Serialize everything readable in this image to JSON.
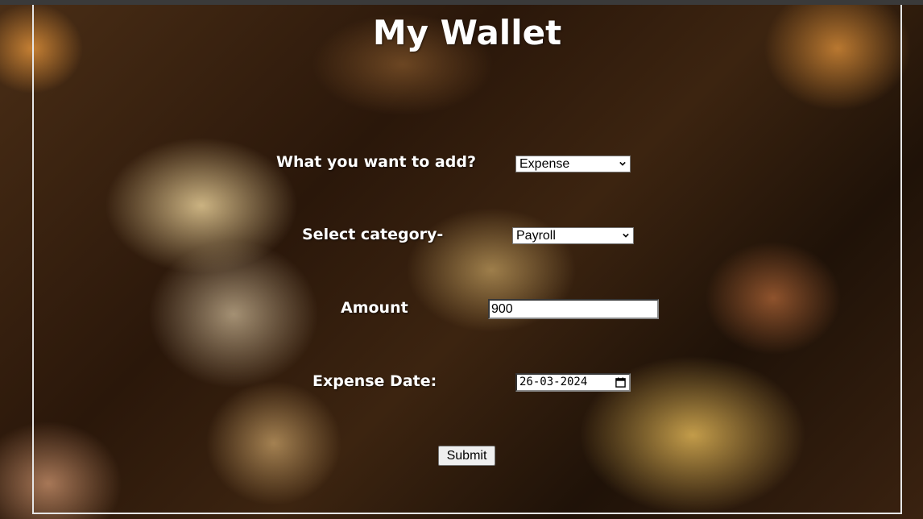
{
  "page": {
    "title": "My Wallet"
  },
  "form": {
    "type_label": "What you want to add?",
    "type_value": "Expense",
    "category_label": "Select category-",
    "category_value": "Payroll",
    "amount_label": "Amount",
    "amount_value": "900",
    "date_label": "Expense Date:",
    "date_value": "26-03-2024",
    "submit_label": "Submit"
  },
  "icons": {
    "select_arrow": "chevron-down-icon",
    "date_picker": "calendar-icon"
  },
  "colors": {
    "label_text": "#ffffff",
    "frame_border": "#e6e6e6"
  }
}
